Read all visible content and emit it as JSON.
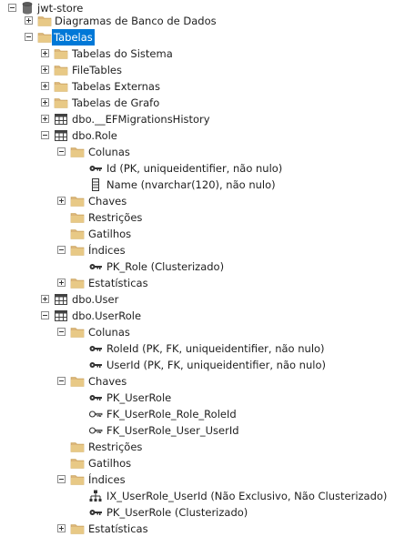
{
  "tree": {
    "server": "jwt-store",
    "diagrams": "Diagramas de Banco de Dados",
    "tables": "Tabelas",
    "system_tables": "Tabelas do Sistema",
    "file_tables": "FileTables",
    "external_tables": "Tabelas Externas",
    "graph_tables": "Tabelas de Grafo",
    "ef_history": "dbo.__EFMigrationsHistory",
    "role": {
      "name": "dbo.Role",
      "columns": "Colunas",
      "col_id": "Id (PK, uniqueidentifier, não nulo)",
      "col_name": "Name (nvarchar(120), não nulo)",
      "keys": "Chaves",
      "constraints": "Restrições",
      "triggers": "Gatilhos",
      "indexes": "Índices",
      "pk_role": "PK_Role (Clusterizado)",
      "stats": "Estatísticas"
    },
    "user": "dbo.User",
    "userrole": {
      "name": "dbo.UserRole",
      "columns": "Colunas",
      "col_roleid": "RoleId (PK, FK, uniqueidentifier, não nulo)",
      "col_userid": "UserId (PK, FK, uniqueidentifier, não nulo)",
      "keys": "Chaves",
      "key_pk": "PK_UserRole",
      "key_fk_role": "FK_UserRole_Role_RoleId",
      "key_fk_user": "FK_UserRole_User_UserId",
      "constraints": "Restrições",
      "triggers": "Gatilhos",
      "indexes": "Índices",
      "ix_userid": "IX_UserRole_UserId (Não Exclusivo, Não Clusterizado)",
      "pk_userrole": "PK_UserRole (Clusterizado)",
      "stats": "Estatísticas"
    }
  },
  "colors": {
    "selection": "#0078d7",
    "folder": "#dcb67a",
    "text": "#1e1e1e"
  }
}
